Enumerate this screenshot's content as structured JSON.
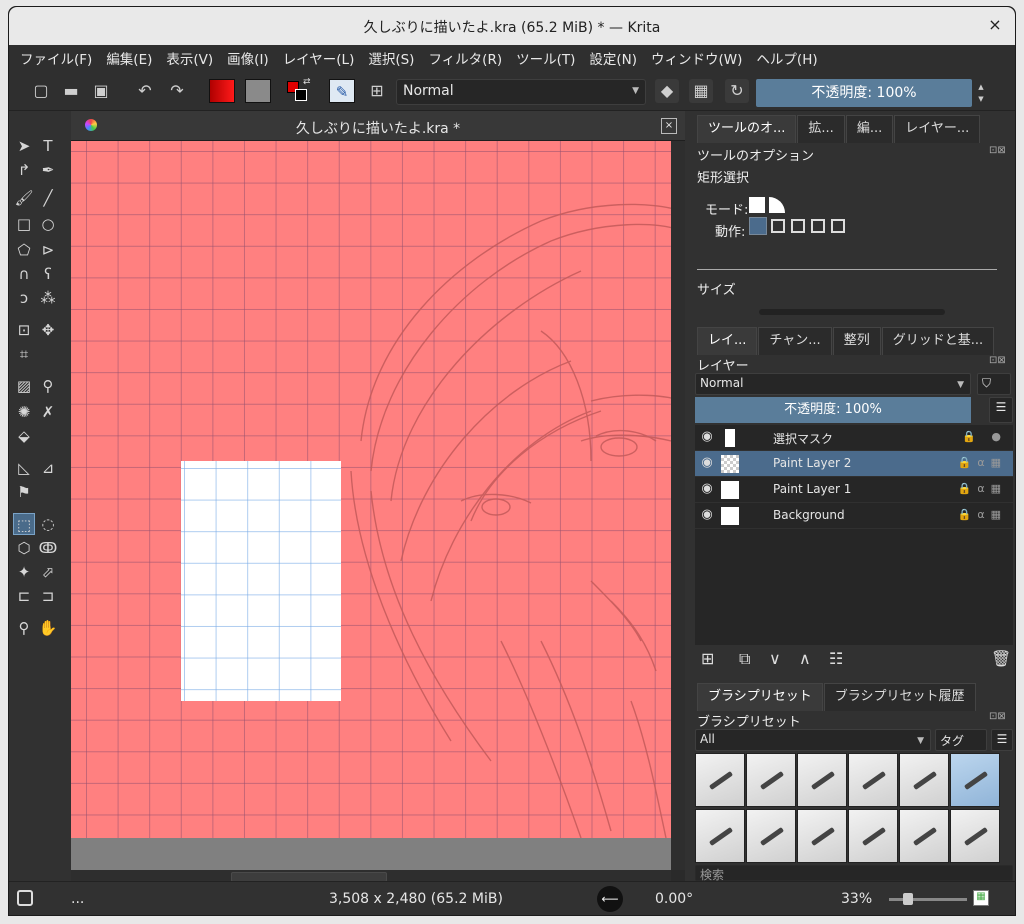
{
  "window": {
    "title": "久しぶりに描いたよ.kra (65.2 MiB)  * — Krita",
    "close_glyph": "×"
  },
  "menu": [
    "ファイル(F)",
    "編集(E)",
    "表示(V)",
    "画像(I)",
    "レイヤー(L)",
    "選択(S)",
    "フィルタ(R)",
    "ツール(T)",
    "設定(N)",
    "ウィンドウ(W)",
    "ヘルプ(H)"
  ],
  "toolbar": {
    "blend_mode": "Normal",
    "opacity": "不透明度: 100%",
    "colors": {
      "foreground": "#e00000",
      "background": "#8a8a8a",
      "canvas": "#ff8080"
    }
  },
  "document": {
    "tab_title": "久しぶりに描いたよ.kra *",
    "close_glyph": "×"
  },
  "dockers": {
    "top_tabs": [
      "ツールのオ...",
      "拡...",
      "編...",
      "レイヤー..."
    ],
    "tool_options": {
      "title": "ツールのオプション",
      "tool": "矩形選択",
      "mode_label": "モード:",
      "action_label": "動作:",
      "size_label": "サイズ"
    },
    "middle_tabs": [
      "レイ...",
      "チャン...",
      "整列",
      "グリッドと基..."
    ],
    "layers": {
      "title": "レイヤー",
      "blend_mode": "Normal",
      "opacity": "不透明度: 100%",
      "items": [
        {
          "name": "選択マスク",
          "active": false
        },
        {
          "name": "Paint Layer 2",
          "active": true
        },
        {
          "name": "Paint Layer 1",
          "active": false
        },
        {
          "name": "Background",
          "active": false
        }
      ]
    },
    "bottom_tabs": [
      "ブラシプリセット",
      "ブラシプリセット履歴"
    ],
    "brush_presets": {
      "title": "ブラシプリセット",
      "filter": "All",
      "tag_label": "タグ",
      "search_placeholder": "検索"
    }
  },
  "status": {
    "dots": "...",
    "dimensions": "3,508 x 2,480 (65.2 MiB)",
    "rotation": "0.00°",
    "zoom": "33%"
  }
}
